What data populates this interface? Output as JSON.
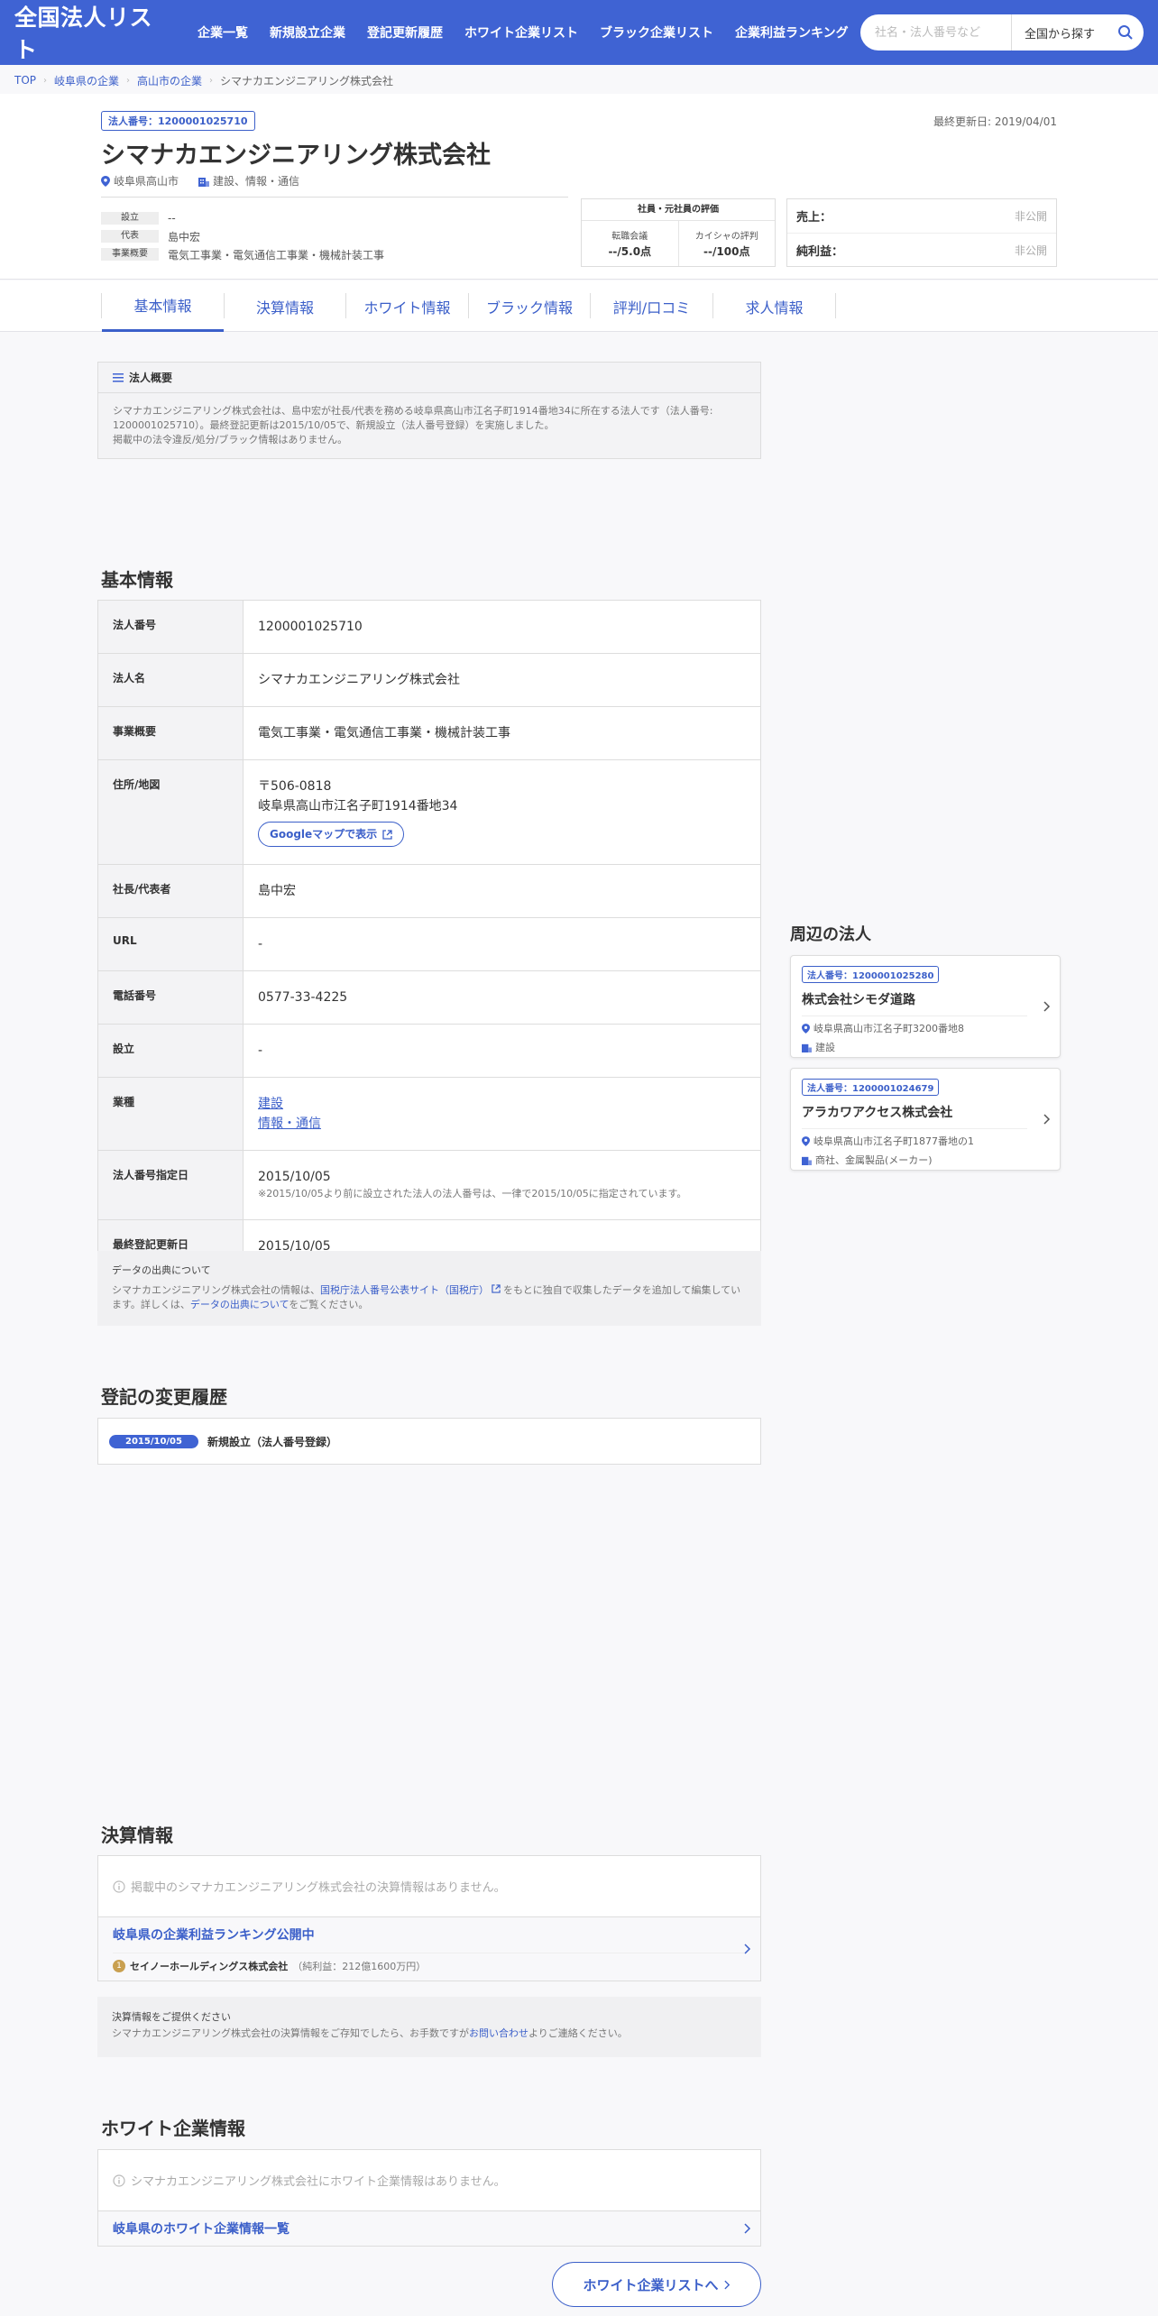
{
  "header": {
    "logo": "全国法人リスト",
    "nav": [
      "企業一覧",
      "新規設立企業",
      "登記更新履歴",
      "ホワイト企業リスト",
      "ブラック企業リスト",
      "企業利益ランキング"
    ],
    "search_placeholder": "社名・法人番号など",
    "search_scope": "全国から探す"
  },
  "breadcrumb": [
    "TOP",
    "岐阜県の企業",
    "高山市の企業",
    "シマナカエンジニアリング株式会社"
  ],
  "company": {
    "badge": "法人番号：1200001025710",
    "updated": "最終更新日: 2019/04/01",
    "name": "シマナカエンジニアリング株式会社",
    "location": "岐阜県高山市",
    "industry": "建設、情報・通信",
    "facts": [
      {
        "label": "設立",
        "value": "--"
      },
      {
        "label": "代表",
        "value": "島中宏"
      },
      {
        "label": "事業概要",
        "value": "電気工事業・電気通信工事業・機械計装工事"
      }
    ],
    "evaluation": {
      "title": "社員・元社員の評価",
      "items": [
        {
          "label": "転職会議",
          "value": "--/5.0点"
        },
        {
          "label": "カイシャの評判",
          "value": "--/100点"
        }
      ]
    },
    "finance": [
      {
        "label": "売上：",
        "value": "非公開"
      },
      {
        "label": "純利益：",
        "value": "非公開"
      }
    ]
  },
  "tabs": [
    "基本情報",
    "決算情報",
    "ホワイト情報",
    "ブラック情報",
    "評判/口コミ",
    "求人情報"
  ],
  "overview": {
    "title": "法人概要",
    "lines": [
      "シマナカエンジニアリング株式会社は、島中宏が社長/代表を務める岐阜県高山市江名子町1914番地34に所在する法人です（法人番号:",
      "1200001025710）。最終登記更新は2015/10/05で、新規設立（法人番号登録）を実施しました。",
      "掲載中の法令違反/処分/ブラック情報はありません。"
    ]
  },
  "basic": {
    "title": "基本情報",
    "rows": [
      {
        "k": "法人番号",
        "v": "1200001025710"
      },
      {
        "k": "法人名",
        "v": "シマナカエンジニアリング株式会社"
      },
      {
        "k": "事業概要",
        "v": "電気工事業・電気通信工事業・機械計装工事"
      },
      {
        "k": "住所/地図",
        "postal": "〒506-0818",
        "addr": "岐阜県高山市江名子町1914番地34",
        "map": "Googleマップで表示"
      },
      {
        "k": "社長/代表者",
        "v": "島中宏"
      },
      {
        "k": "URL",
        "v": "-"
      },
      {
        "k": "電話番号",
        "v": "0577-33-4225"
      },
      {
        "k": "設立",
        "v": "-"
      },
      {
        "k": "業種",
        "links": [
          "建設",
          "情報・通信"
        ]
      },
      {
        "k": "法人番号指定日",
        "v": "2015/10/05",
        "note": "※2015/10/05より前に設立された法人の法人番号は、一律で2015/10/05に指定されています。"
      },
      {
        "k": "最終登記更新日",
        "v": "2015/10/05"
      }
    ]
  },
  "source": {
    "title": "データの出典について",
    "text1": "シマナカエンジニアリング株式会社の情報は、",
    "link1": "国税庁法人番号公表サイト（国税庁）",
    "text2": "をもとに独自で収集したデータを追加して編集してい",
    "text3": "ます。詳しくは、",
    "link2": "データの出典について",
    "text4": "をご覧ください。"
  },
  "history": {
    "title": "登記の変更履歴",
    "items": [
      {
        "date": "2015/10/05",
        "text": "新規設立（法人番号登録）"
      }
    ]
  },
  "settlement": {
    "title": "決算情報",
    "empty": "掲載中のシマナカエンジニアリング株式会社の決算情報はありません。",
    "ranking_title": "岐阜県の企業利益ランキング公開中",
    "rank_num": "1",
    "rank_company": "セイノーホールディングス株式会社",
    "rank_sub": "（純利益：212億1600万円）"
  },
  "provide": {
    "title": "決算情報をご提供ください",
    "text1": "シマナカエンジニアリング株式会社の決算情報をご存知でしたら、お手数ですが",
    "link": "お問い合わせ",
    "text2": "よりご連絡ください。"
  },
  "white": {
    "title": "ホワイト企業情報",
    "empty": "シマナカエンジニアリング株式会社にホワイト企業情報はありません。",
    "link": "岐阜県のホワイト企業情報一覧",
    "button": "ホワイト企業リストへ"
  },
  "nearby": {
    "title": "周辺の法人",
    "items": [
      {
        "badge": "法人番号：1200001025280",
        "name": "株式会社シモダ道路",
        "addr": "岐阜県高山市江名子町3200番地8",
        "ind": "建設"
      },
      {
        "badge": "法人番号：1200001024679",
        "name": "アラカワアクセス株式会社",
        "addr": "岐阜県高山市江名子町1877番地の1",
        "ind": "商社、金属製品(メーカー)"
      }
    ]
  },
  "colors": {
    "primary": "#3f63d3",
    "link": "#3b5fc9",
    "gold": "#c9a050"
  }
}
